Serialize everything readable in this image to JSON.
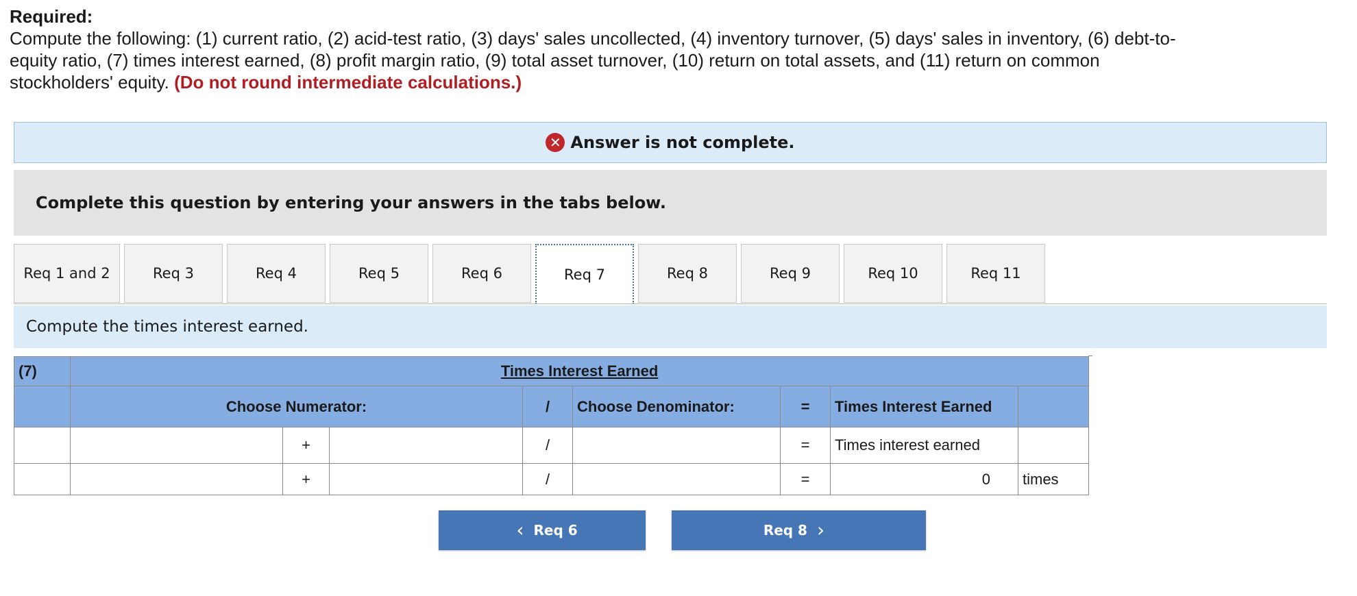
{
  "required": {
    "heading": "Required:",
    "text": "Compute the following: (1) current ratio, (2) acid-test ratio, (3) days' sales uncollected, (4) inventory turnover, (5) days' sales in inventory, (6) debt-to-equity ratio, (7) times interest earned, (8) profit margin ratio, (9) total asset turnover, (10) return on total assets, and (11) return on common stockholders' equity.",
    "warning": "(Do not round intermediate calculations.)"
  },
  "banner": {
    "icon": "close-icon",
    "text": "Answer is not complete.",
    "color": "#c0272d"
  },
  "instruction": "Complete this question by entering your answers in the tabs below.",
  "tabs": [
    {
      "label": "Req 1 and 2"
    },
    {
      "label": "Req 3"
    },
    {
      "label": "Req 4"
    },
    {
      "label": "Req 5"
    },
    {
      "label": "Req 6"
    },
    {
      "label": "Req 7",
      "active": true
    },
    {
      "label": "Req 8"
    },
    {
      "label": "Req 9"
    },
    {
      "label": "Req 10"
    },
    {
      "label": "Req 11"
    }
  ],
  "prompt": "Compute the times interest earned.",
  "table": {
    "req_num": "(7)",
    "title": "Times Interest Earned",
    "numerator_header": "Choose Numerator:",
    "slash": "/",
    "denominator_header": "Choose Denominator:",
    "equals": "=",
    "result_header": "Times Interest Earned",
    "row1": {
      "plus": "+",
      "slash": "/",
      "equals": "=",
      "result_label": "Times interest earned"
    },
    "row2": {
      "plus": "+",
      "slash": "/",
      "equals": "=",
      "result_value": "0",
      "unit": "times"
    }
  },
  "nav": {
    "prev": "Req 6",
    "next": "Req 8",
    "color": "#4676b6"
  }
}
